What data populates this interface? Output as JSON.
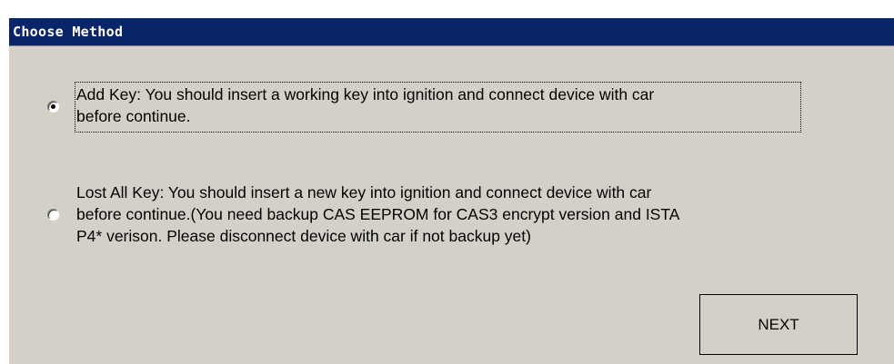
{
  "dialog": {
    "title": "Choose Method"
  },
  "options": [
    {
      "label": "Add Key: You should insert a working key into ignition and connect device with car\nbefore continue.",
      "selected": true
    },
    {
      "label": "Lost All Key: You should insert a new key into ignition and connect device with car\nbefore continue.(You need backup CAS EEPROM for CAS3 encrypt version and ISTA\nP4* verison. Please disconnect device with car if not backup yet)",
      "selected": false
    }
  ],
  "actions": {
    "next_label": "NEXT"
  },
  "colors": {
    "title_bar": "#0a246a",
    "dialog_bg": "#d4d0c8"
  }
}
